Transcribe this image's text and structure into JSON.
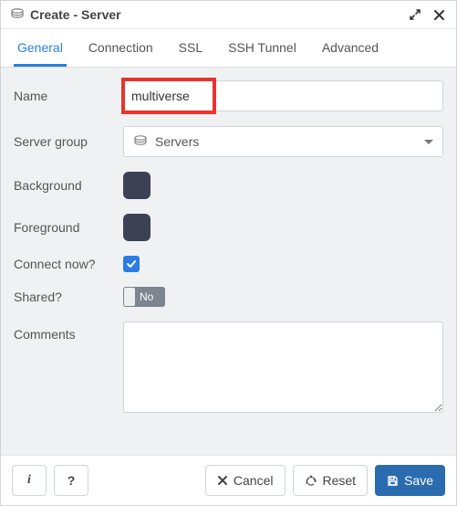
{
  "window": {
    "title": "Create - Server"
  },
  "tabs": [
    {
      "label": "General"
    },
    {
      "label": "Connection"
    },
    {
      "label": "SSL"
    },
    {
      "label": "SSH Tunnel"
    },
    {
      "label": "Advanced"
    }
  ],
  "fields": {
    "name_label": "Name",
    "name_value": "multiverse",
    "server_group_label": "Server group",
    "server_group_value": "Servers",
    "background_label": "Background",
    "background_color": "#3c4154",
    "foreground_label": "Foreground",
    "foreground_color": "#3c4154",
    "connect_now_label": "Connect now?",
    "connect_now_checked": true,
    "shared_label": "Shared?",
    "shared_value": "No",
    "comments_label": "Comments",
    "comments_value": ""
  },
  "footer": {
    "info_label": "i",
    "help_label": "?",
    "cancel_label": "Cancel",
    "reset_label": "Reset",
    "save_label": "Save"
  }
}
